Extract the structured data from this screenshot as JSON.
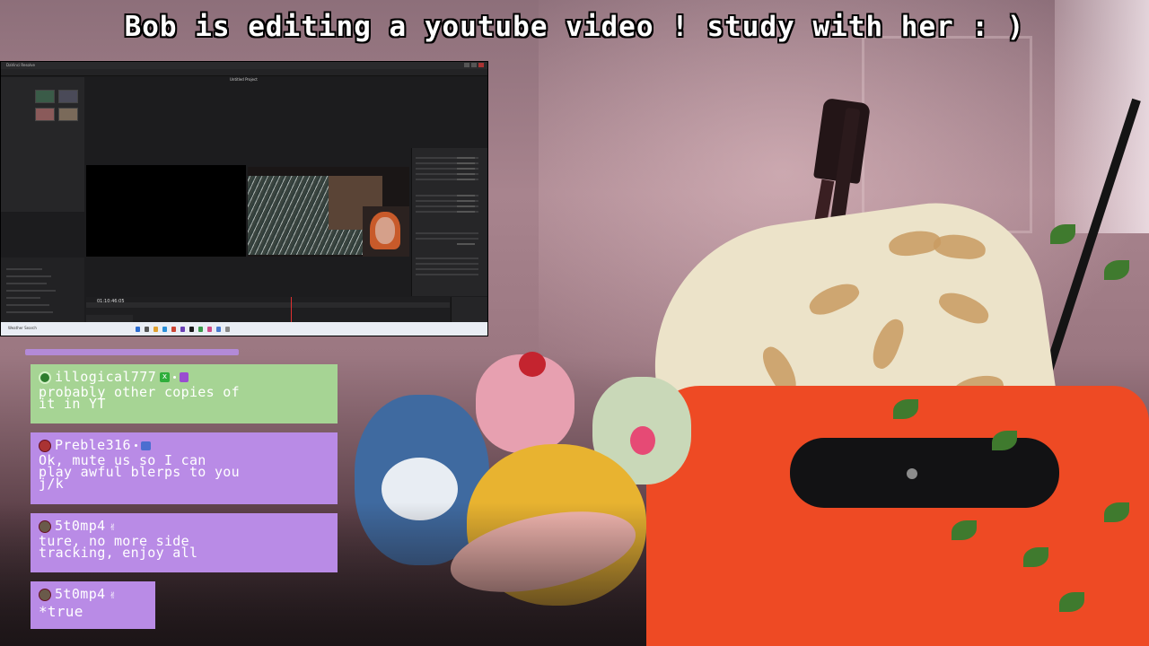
{
  "stream": {
    "title": "Bob is editing a youtube video ! study with her : )"
  },
  "editor": {
    "window_title": "DaVinci Resolve",
    "project_name": "Untitled Project",
    "timecode": "01:10:46:05",
    "taskbar_label": "Weather Search"
  },
  "chat": {
    "messages": [
      {
        "username": "illogical777",
        "text": "probably other copies of\nit in YT",
        "color": "#a6d494",
        "badges": [
          "user-icon",
          "xbox-badge-icon",
          "gift-badge-icon"
        ]
      },
      {
        "username": "Preble316",
        "text": "Ok, mute us so I can\nplay awful blerps to you\nj/k",
        "color": "#b98be6",
        "badges": [
          "avatar-icon",
          "robot-badge-icon"
        ]
      },
      {
        "username": "5t0mp4",
        "text": "ture, no more side\ntracking, enjoy all",
        "color": "#b98be6",
        "badges": [
          "avatar-icon",
          "hand-badge-icon"
        ]
      },
      {
        "username": "5t0mp4",
        "text": "*true",
        "color": "#b98be6",
        "badges": [
          "avatar-icon",
          "hand-badge-icon"
        ]
      }
    ]
  }
}
